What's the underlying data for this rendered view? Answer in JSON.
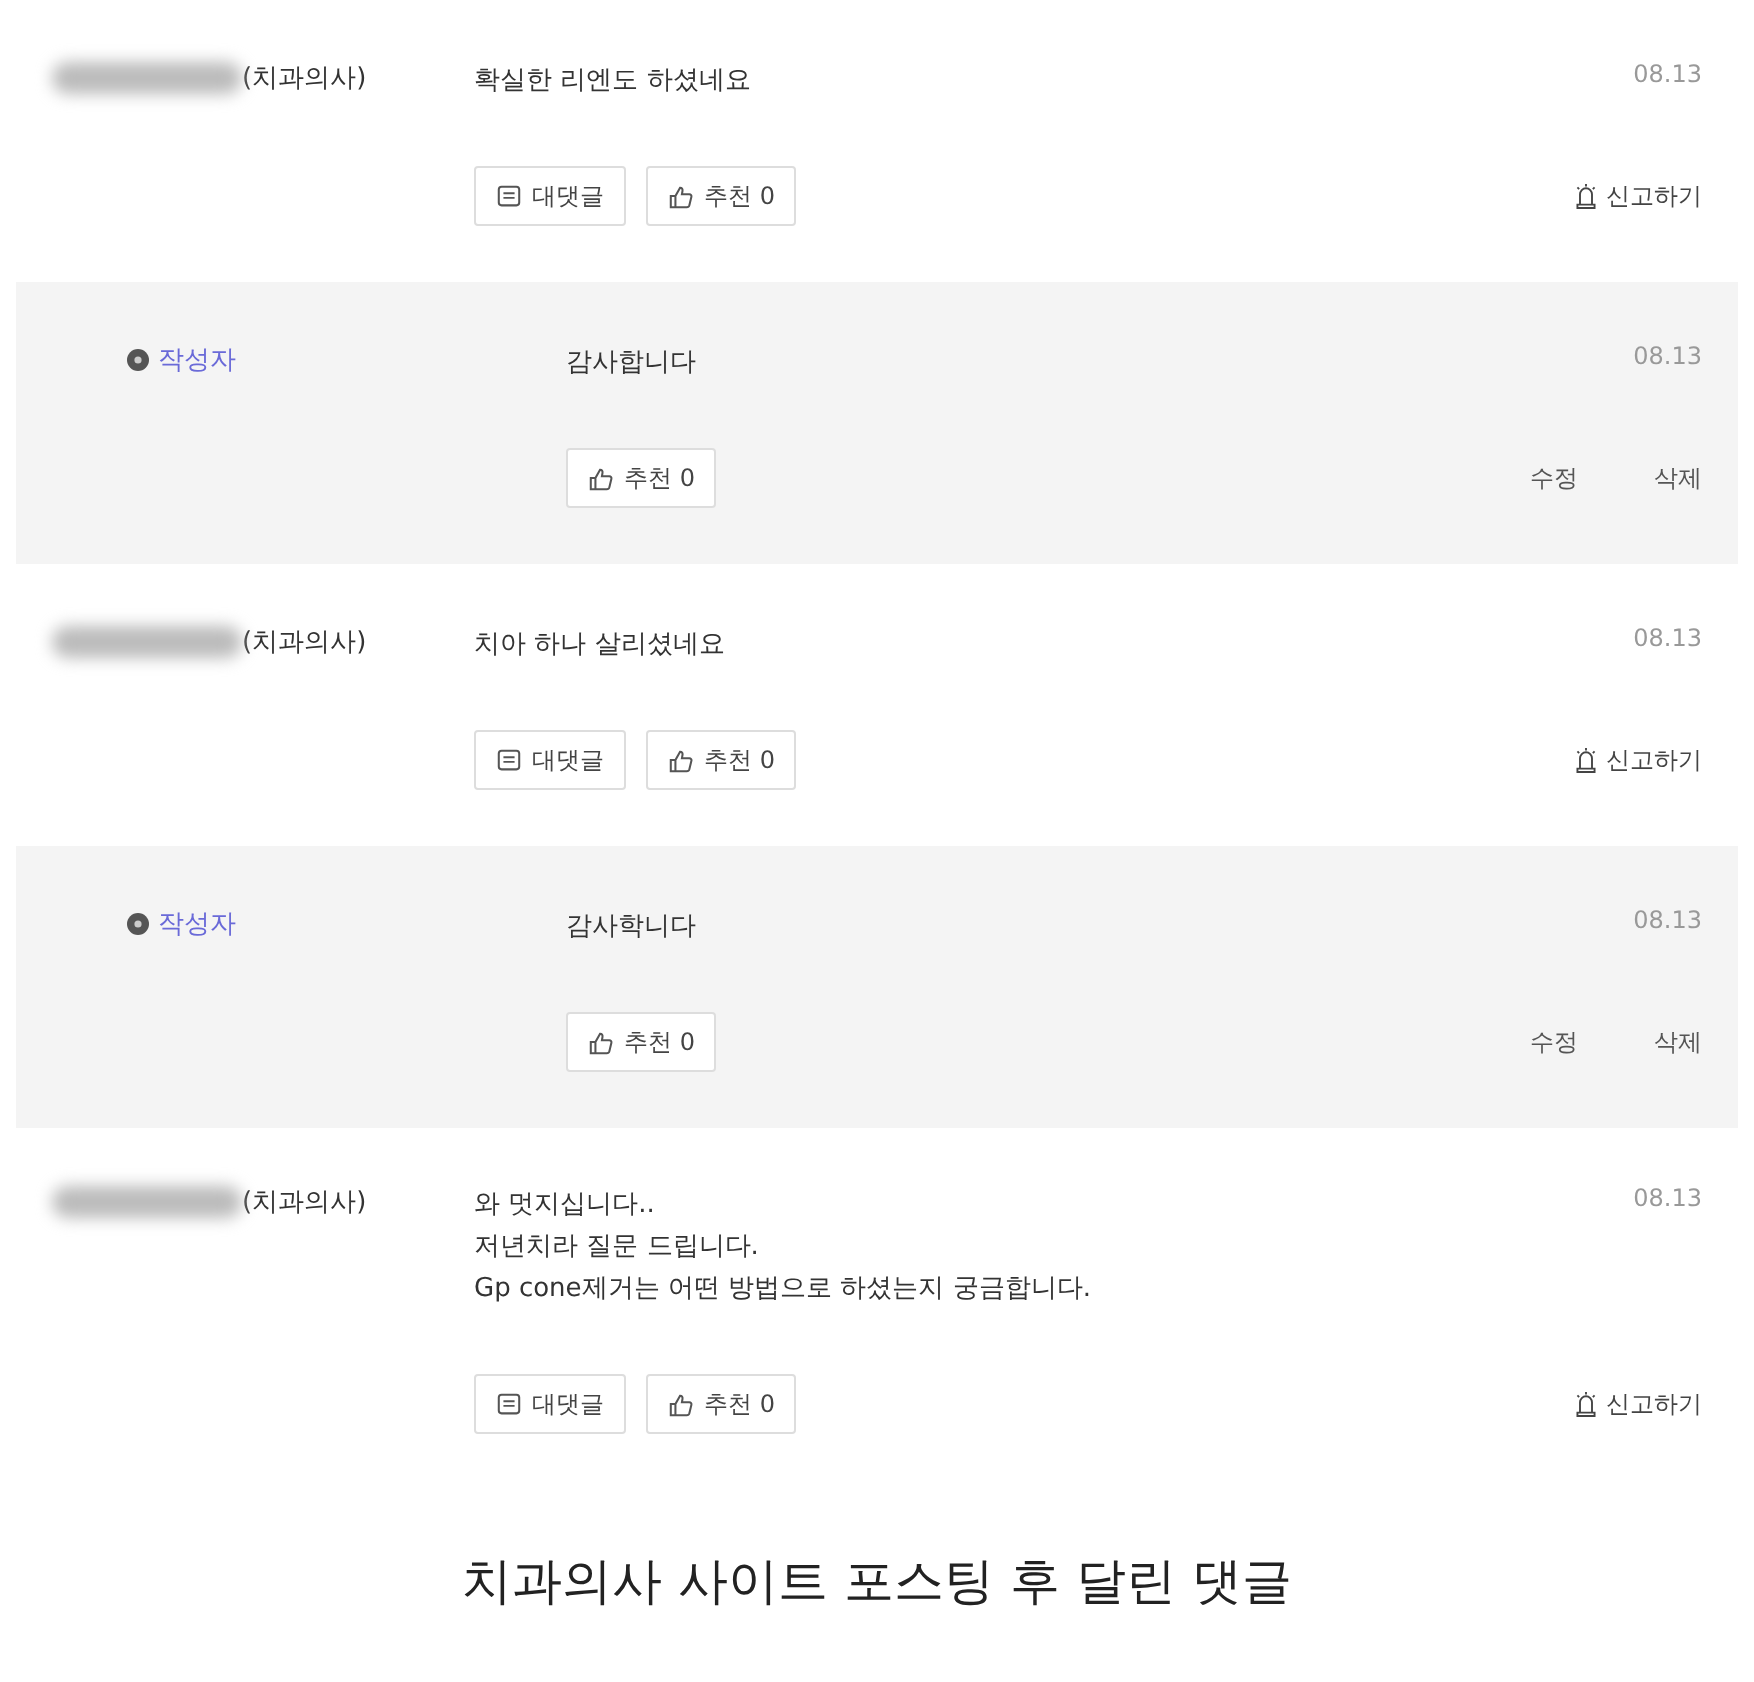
{
  "comments": [
    {
      "kind": "comment",
      "author_suffix": "(치과의사)",
      "lines": [
        "확실한 리엔도 하셨네요"
      ],
      "date": "08.13",
      "reply_button": "대댓글",
      "like_button": "추천 0",
      "report_link": "신고하기"
    },
    {
      "kind": "reply",
      "author": "작성자",
      "lines": [
        "감사합니다"
      ],
      "date": "08.13",
      "like_button": "추천 0",
      "edit_link": "수정",
      "delete_link": "삭제"
    },
    {
      "kind": "comment",
      "author_suffix": "(치과의사)",
      "lines": [
        "치아 하나 살리셨네요"
      ],
      "date": "08.13",
      "reply_button": "대댓글",
      "like_button": "추천 0",
      "report_link": "신고하기"
    },
    {
      "kind": "reply",
      "author": "작성자",
      "lines": [
        "감사학니다"
      ],
      "date": "08.13",
      "like_button": "추천 0",
      "edit_link": "수정",
      "delete_link": "삭제"
    },
    {
      "kind": "comment",
      "author_suffix": "(치과의사)",
      "lines": [
        "와 멋지십니다..",
        "저년치라 질문 드립니다.",
        "Gp cone제거는 어떤 방법으로 하셨는지 궁금합니다."
      ],
      "date": "08.13",
      "reply_button": "대댓글",
      "like_button": "추천 0",
      "report_link": "신고하기"
    }
  ],
  "caption": "치과의사 사이트 포스팅 후 달린 댓글"
}
